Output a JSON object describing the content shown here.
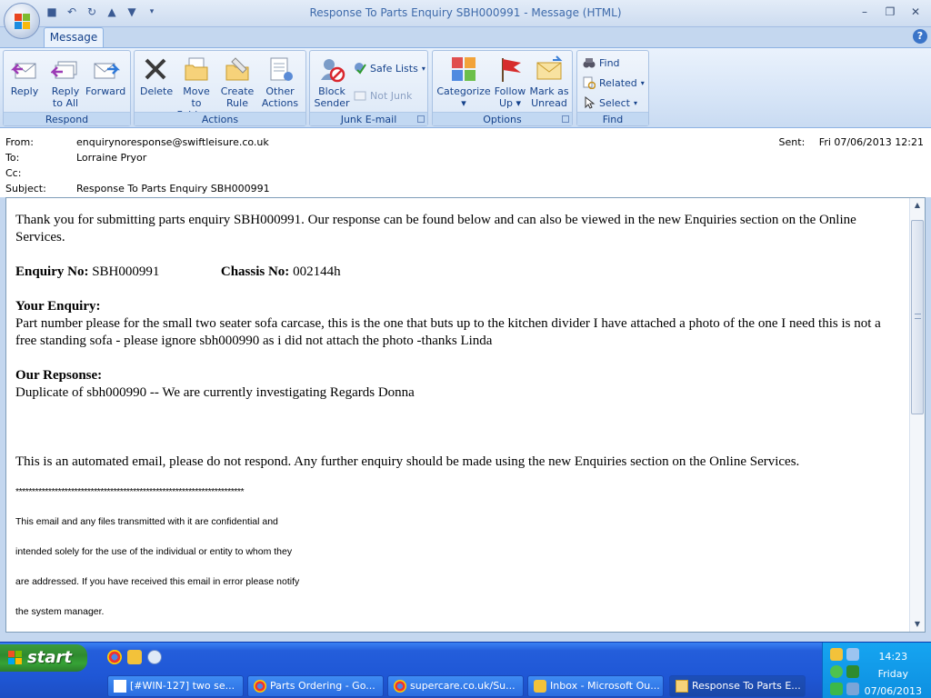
{
  "window": {
    "title": "Response To Parts Enquiry SBH000991 - Message (HTML)",
    "help": "?"
  },
  "tabs": [
    {
      "label": "Message"
    }
  ],
  "ribbon": {
    "groups": {
      "respond": "Respond",
      "actions": "Actions",
      "junk": "Junk E-mail",
      "options": "Options",
      "find": "Find"
    },
    "buttons": {
      "reply": "Reply",
      "reply_all_1": "Reply",
      "reply_all_2": "to All",
      "forward": "Forward",
      "delete": "Delete",
      "move_1": "Move to",
      "move_2": "Folder",
      "create_1": "Create",
      "create_2": "Rule",
      "other_1": "Other",
      "other_2": "Actions",
      "block_1": "Block",
      "block_2": "Sender",
      "safe_lists": "Safe Lists",
      "not_junk": "Not Junk",
      "categorize": "Categorize",
      "follow_1": "Follow",
      "follow_2": "Up",
      "mark_1": "Mark as",
      "mark_2": "Unread",
      "find": "Find",
      "related": "Related",
      "select": "Select"
    }
  },
  "header": {
    "from_label": "From:",
    "from": "enquirynoresponse@swiftleisure.co.uk",
    "to_label": "To:",
    "to": "Lorraine Pryor",
    "cc_label": "Cc:",
    "cc": "",
    "subject_label": "Subject:",
    "subject": "Response To Parts Enquiry SBH000991",
    "sent_label": "Sent:",
    "sent": "Fri 07/06/2013 12:21"
  },
  "body": {
    "intro": "Thank you for submitting parts enquiry SBH000991. Our response can be found below and can also be viewed in the new Enquiries section on the Online Services.",
    "enquiry_no_label": "Enquiry No:",
    "enquiry_no": "SBH000991",
    "chassis_no_label": "Chassis No:",
    "chassis_no": "002144h",
    "your_enquiry_label": "Your Enquiry:",
    "your_enquiry": "Part number please for the small two seater sofa carcase, this is the one that buts up to the kitchen divider I have attached a photo of the one I need this is not a free standing sofa - please ignore sbh000990 as i did not attach the photo -thanks Linda",
    "response_label": "Our Repsonse:",
    "response": "Duplicate of sbh000990 -- We are currently investigating Regards Donna",
    "automated": "This is an automated email, please do not respond. Any further enquiry should be made using the new Enquiries section on the Online Services.",
    "stars": "**********************************************************************",
    "disclaimer_1": "This email and any files transmitted with it are confidential and",
    "disclaimer_2": "intended solely for the use of the individual or entity to whom they",
    "disclaimer_3": "are addressed. If you have received this email in error please notify",
    "disclaimer_4": "the system manager."
  },
  "taskbar": {
    "start": "start",
    "buttons": [
      {
        "label": "[#WIN-127] two se..."
      },
      {
        "label": "Parts Ordering - Go..."
      },
      {
        "label": "supercare.co.uk/Su..."
      },
      {
        "label": "Inbox - Microsoft Ou..."
      },
      {
        "label": "Response To Parts E..."
      }
    ],
    "clock_time": "14:23",
    "clock_day": "Friday",
    "clock_date": "07/06/2013"
  },
  "colors": {
    "ribbon_text": "#15428b",
    "taskbar": "#245edb",
    "start_green": "#2f8a2f"
  }
}
